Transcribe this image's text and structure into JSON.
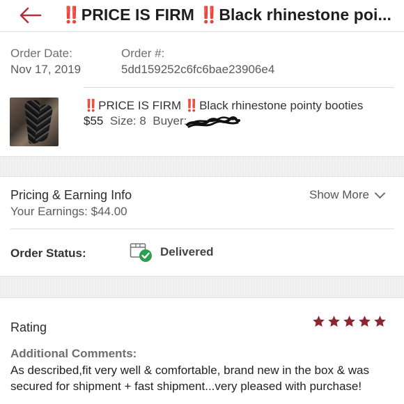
{
  "header": {
    "title_prefix": "‼️",
    "title_text_1": "PRICE IS FIRM ",
    "title_bang_2": "‼️",
    "title_text_2": "Black rhinestone poi...",
    "back_icon": "back-arrow-icon",
    "accent_color": "#b5303a"
  },
  "order": {
    "date_label": "Order Date:",
    "date_value": "Nov 17, 2019",
    "number_label": "Order #:",
    "number_value": "5dd159252c6fc6bae23906e4"
  },
  "item": {
    "title_bang_1": "‼️",
    "title_text_1": "PRICE IS FIRM ",
    "title_bang_2": "‼️",
    "title_text_2": "Black rhinestone pointy booties",
    "price": "$55",
    "size": "Size: 8",
    "buyer_label": "Buyer:"
  },
  "pricing": {
    "title": "Pricing & Earning Info",
    "earnings": "Your Earnings: $44.00",
    "show_more": "Show More"
  },
  "status": {
    "label": "Order Status:",
    "value": "Delivered",
    "icon": "delivered-box-check-icon",
    "icon_color": "#2e9e4f"
  },
  "rating": {
    "label": "Rating",
    "stars": 5,
    "max_stars": 5,
    "star_color": "#8a2733"
  },
  "comments": {
    "label": "Additional Comments:",
    "text": "As described,fit very well & comfortable, brand new in the box & was secured for shipment + fast shipment...very pleased with purchase!"
  }
}
